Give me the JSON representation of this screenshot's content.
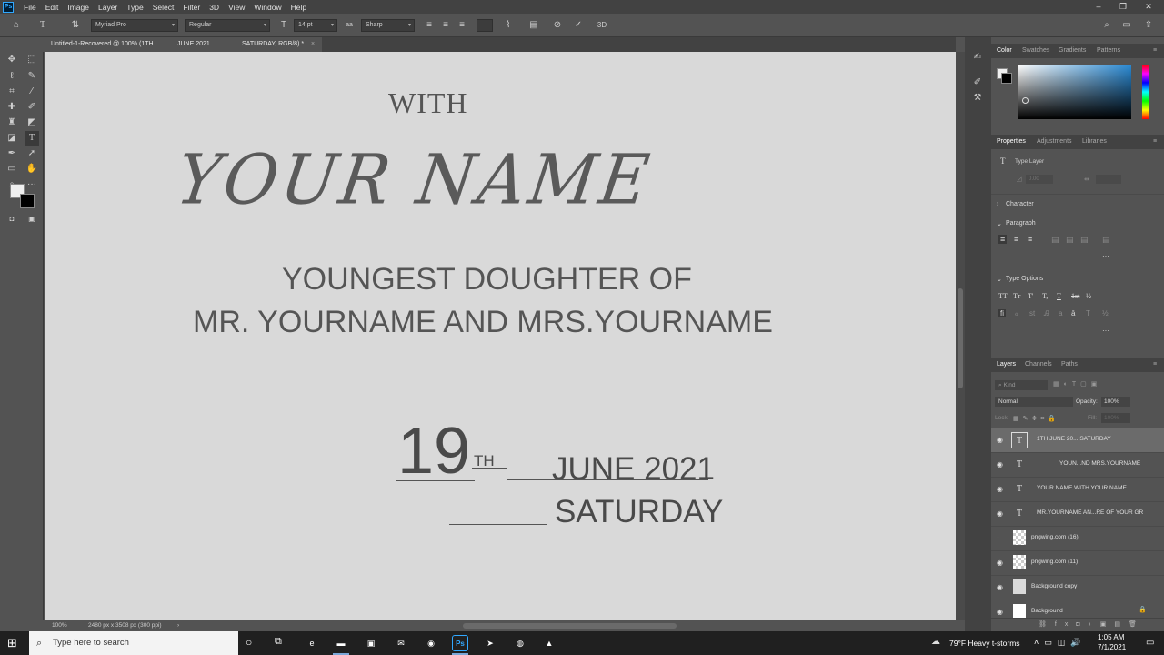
{
  "app": {
    "logo": "Ps"
  },
  "menu": [
    "File",
    "Edit",
    "Image",
    "Layer",
    "Type",
    "Select",
    "Filter",
    "3D",
    "View",
    "Window",
    "Help"
  ],
  "window_controls": {
    "minimize": "–",
    "restore": "❐",
    "close": "✕"
  },
  "options_bar": {
    "font_family": "Myriad Pro",
    "font_style": "Regular",
    "font_size": "14 pt",
    "antialias_icon": "aa",
    "antialias": "Sharp",
    "three_d": "3D"
  },
  "document_tab": {
    "title_parts": [
      "Untitled-1-Recovered @ 100% (1TH",
      "JUNE 2021",
      "SATURDAY, RGB/8) *"
    ],
    "close": "×"
  },
  "canvas": {
    "with": "WITH",
    "your_name": "YOUR NAME",
    "line1": "YOUNGEST DOUGHTER OF",
    "line2": "MR. YOURNAME AND MRS.YOURNAME",
    "day": "19",
    "suffix": "TH",
    "month_year": "JUNE 2021",
    "weekday": "SATURDAY"
  },
  "status": {
    "zoom": "100%",
    "doc_info": "2480 px x 3508 px (300 ppi)",
    "arrow": "›"
  },
  "color_panel": {
    "tabs": [
      "Color",
      "Swatches",
      "Gradients",
      "Patterns"
    ]
  },
  "properties_panel": {
    "tabs": [
      "Properties",
      "Adjustments",
      "Libraries"
    ],
    "layer_type": "Type Layer",
    "tracking_value": "0.00",
    "character": "Character",
    "paragraph": "Paragraph",
    "type_options": "Type Options",
    "type_buttons": [
      "TT",
      "Tт",
      "T'",
      "T,",
      "T",
      "1st",
      "½"
    ],
    "more": "···"
  },
  "layers_panel": {
    "tabs": [
      "Layers",
      "Channels",
      "Paths"
    ],
    "kind": "Kind",
    "blend_mode": "Normal",
    "opacity_label": "Opacity:",
    "opacity": "100%",
    "lock_label": "Lock:",
    "fill_label": "Fill:",
    "fill": "100%",
    "layers": [
      {
        "name": "1TH          JUNE 20...          SATURDAY",
        "kind": "T",
        "visible": true,
        "selected": true
      },
      {
        "name": "YOUN...ND MRS.YOURNAME",
        "kind": "T",
        "visible": true,
        "selected": false
      },
      {
        "name": "YOUR NAME              WITH YOUR NAME",
        "kind": "T",
        "visible": true,
        "selected": false
      },
      {
        "name": "MR.YOURNAME AN...RE OF YOUR GR",
        "kind": "T",
        "visible": true,
        "selected": false
      },
      {
        "name": "pngwing.com (16)",
        "kind": "img",
        "visible": false,
        "selected": false
      },
      {
        "name": "pngwing.com (11)",
        "kind": "img",
        "visible": true,
        "selected": false
      },
      {
        "name": "Background copy",
        "kind": "fill",
        "visible": true,
        "selected": false
      },
      {
        "name": "Background",
        "kind": "fill",
        "visible": true,
        "selected": false
      }
    ]
  },
  "taskbar": {
    "search_placeholder": "Type here to search",
    "weather": "79°F  Heavy t-storms",
    "time": "1:05 AM",
    "date": "7/1/2021",
    "icons": [
      {
        "name": "edge-icon",
        "label": "e",
        "color": "#1b8ad6"
      },
      {
        "name": "explorer-icon",
        "label": "▬",
        "color": "#e7a92d"
      },
      {
        "name": "store-icon",
        "label": "▣",
        "color": "#3a3a3a"
      },
      {
        "name": "mail-icon",
        "label": "✉",
        "color": "#1e6fcf"
      },
      {
        "name": "app-red-icon",
        "label": "◉",
        "color": "#c0262b"
      },
      {
        "name": "photoshop-icon",
        "label": "Ps",
        "color": "#001e36"
      },
      {
        "name": "telegram-icon",
        "label": "➤",
        "color": "#2aa3df"
      },
      {
        "name": "chrome-icon",
        "label": "◍",
        "color": "#db4437"
      },
      {
        "name": "photos-icon",
        "label": "▲",
        "color": "#2b7cd3"
      }
    ]
  }
}
